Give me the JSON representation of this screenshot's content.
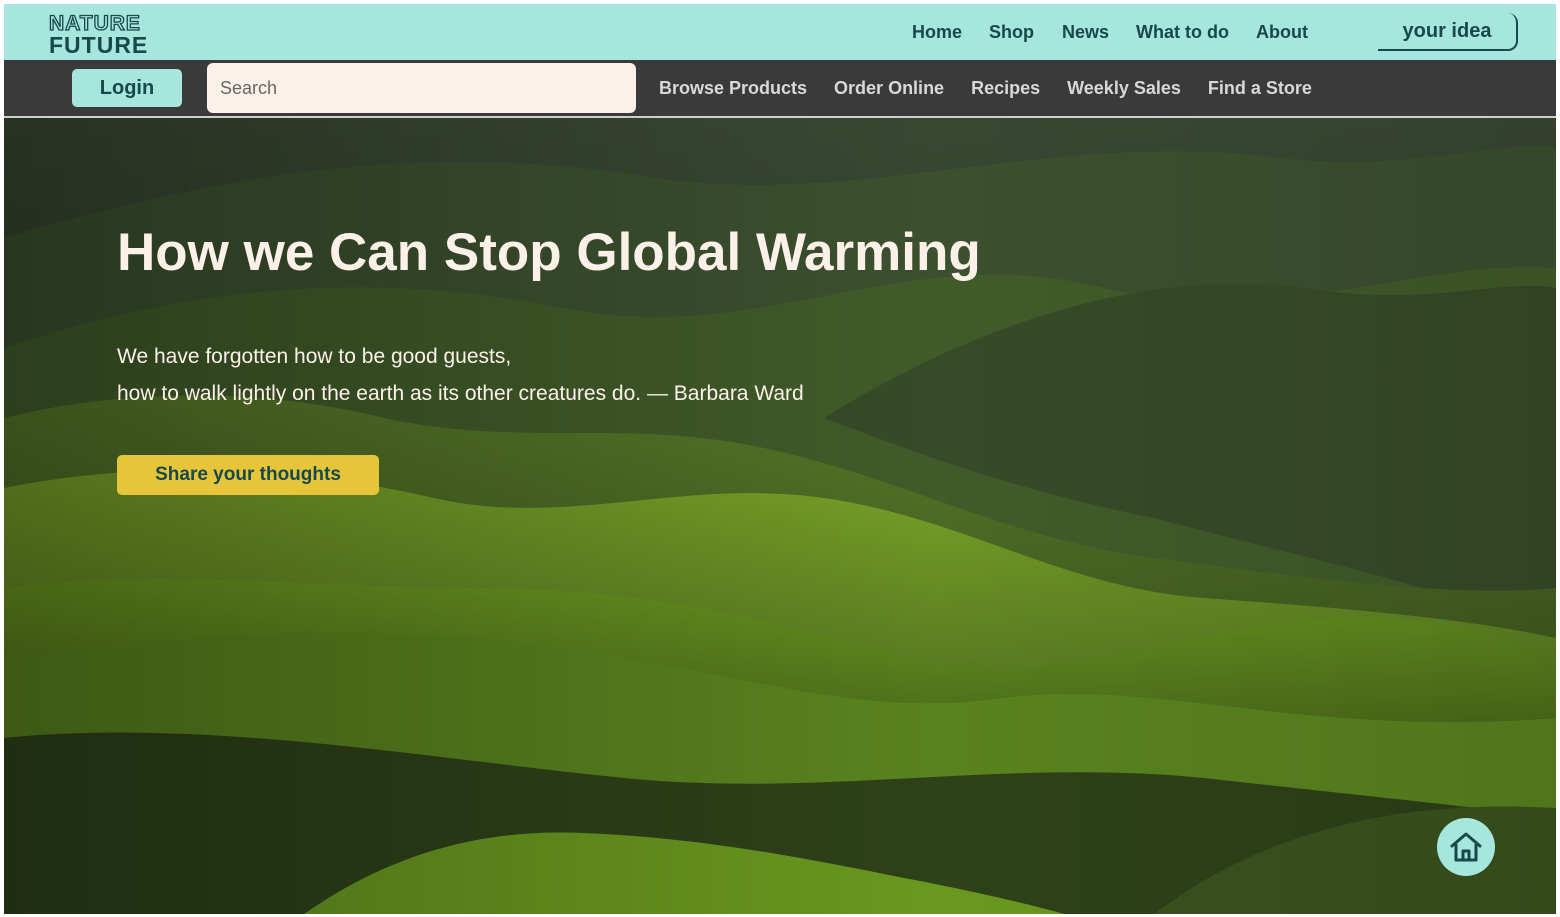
{
  "brand": {
    "line1": "NATURE",
    "line2": "FUTURE"
  },
  "top_nav": {
    "items": [
      "Home",
      "Shop",
      "News",
      "What to do",
      "About"
    ],
    "cta_label": "your idea"
  },
  "sub_nav": {
    "login_label": "Login",
    "search_placeholder": "Search",
    "search_value": "",
    "items": [
      "Browse Products",
      "Order Online",
      "Recipes",
      "Weekly Sales",
      "Find a Store"
    ]
  },
  "hero": {
    "title": "How we Can Stop Global Warming",
    "quote_line1": "We have forgotten how to be good guests,",
    "quote_line2": "how to walk lightly on the earth as its other creatures do. — Barbara Ward",
    "button_label": "Share your thoughts"
  },
  "icons": {
    "home_fab": "home-icon"
  },
  "colors": {
    "accent_mint": "#a6e6dd",
    "dark_teal": "#17484a",
    "subbar": "#3a3a3a",
    "cta_yellow": "#e7c53a",
    "cream": "#fbf1e8"
  }
}
